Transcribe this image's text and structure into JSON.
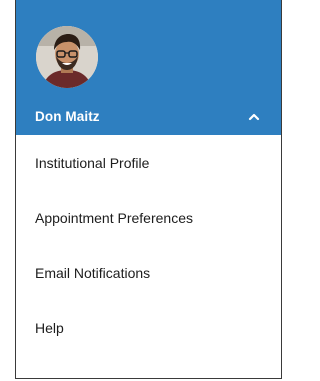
{
  "user": {
    "name": "Don Maitz",
    "avatar_icon": "user-avatar-photo",
    "toggle_icon": "chevron-up-icon"
  },
  "menu": {
    "items": [
      {
        "label": "Institutional Profile"
      },
      {
        "label": "Appointment Preferences"
      },
      {
        "label": "Email Notifications"
      },
      {
        "label": "Help"
      }
    ]
  },
  "colors": {
    "header_bg": "#2e7fc0",
    "header_text": "#ffffff",
    "menu_text": "#1d1d1d"
  }
}
